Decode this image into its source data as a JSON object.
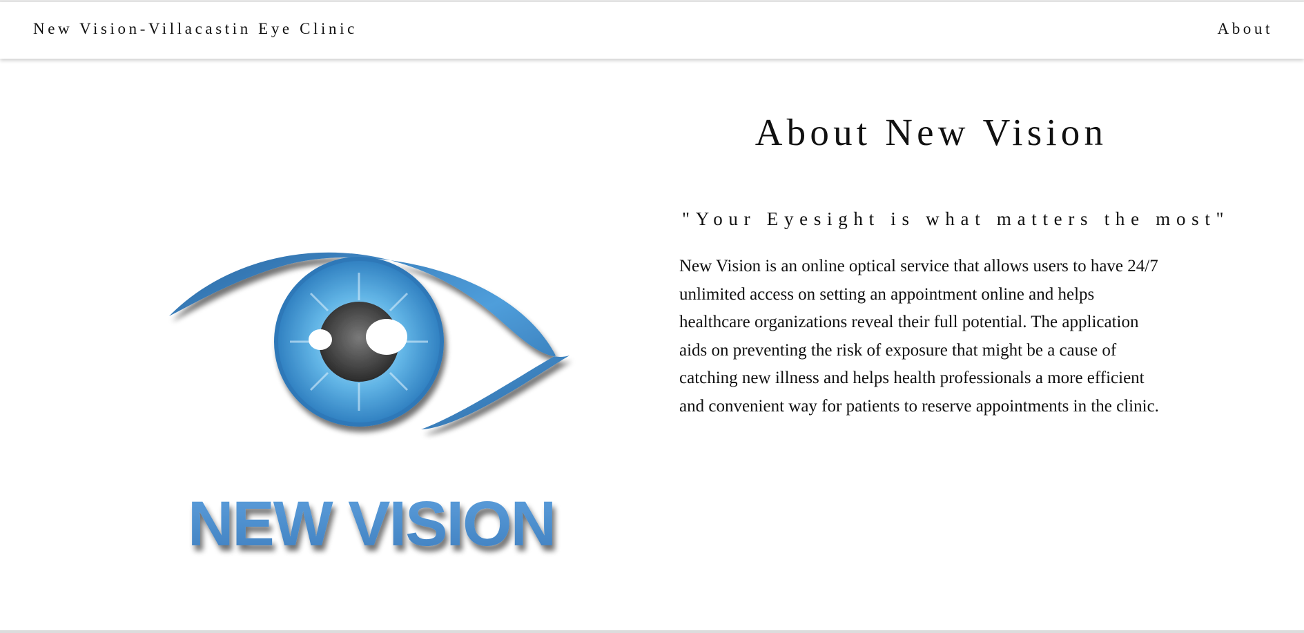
{
  "navbar": {
    "brand": "New Vision-Villacastin Eye Clinic",
    "about_link": "About"
  },
  "logo": {
    "icon": "eye-icon",
    "wordmark": "NEW VISION",
    "colors": {
      "iris": "#4aa3db",
      "brow": "#3f86c4",
      "pupil": "#3a3a3a",
      "wordmark": "#4f8fcf"
    }
  },
  "about": {
    "title": "About New Vision",
    "tagline": "\"Your Eyesight is what matters the most\"",
    "description_lines": [
      "New Vision is an online optical service that allows users to have 24/7",
      "unlimited access on setting an appointment online and helps",
      "healthcare organizations reveal their full potential. The application",
      "aids on preventing the risk of exposure that might be a cause of",
      "catching new illness and helps health professionals a more efficient",
      "and convenient way for patients to reserve appointments in the clinic."
    ]
  }
}
